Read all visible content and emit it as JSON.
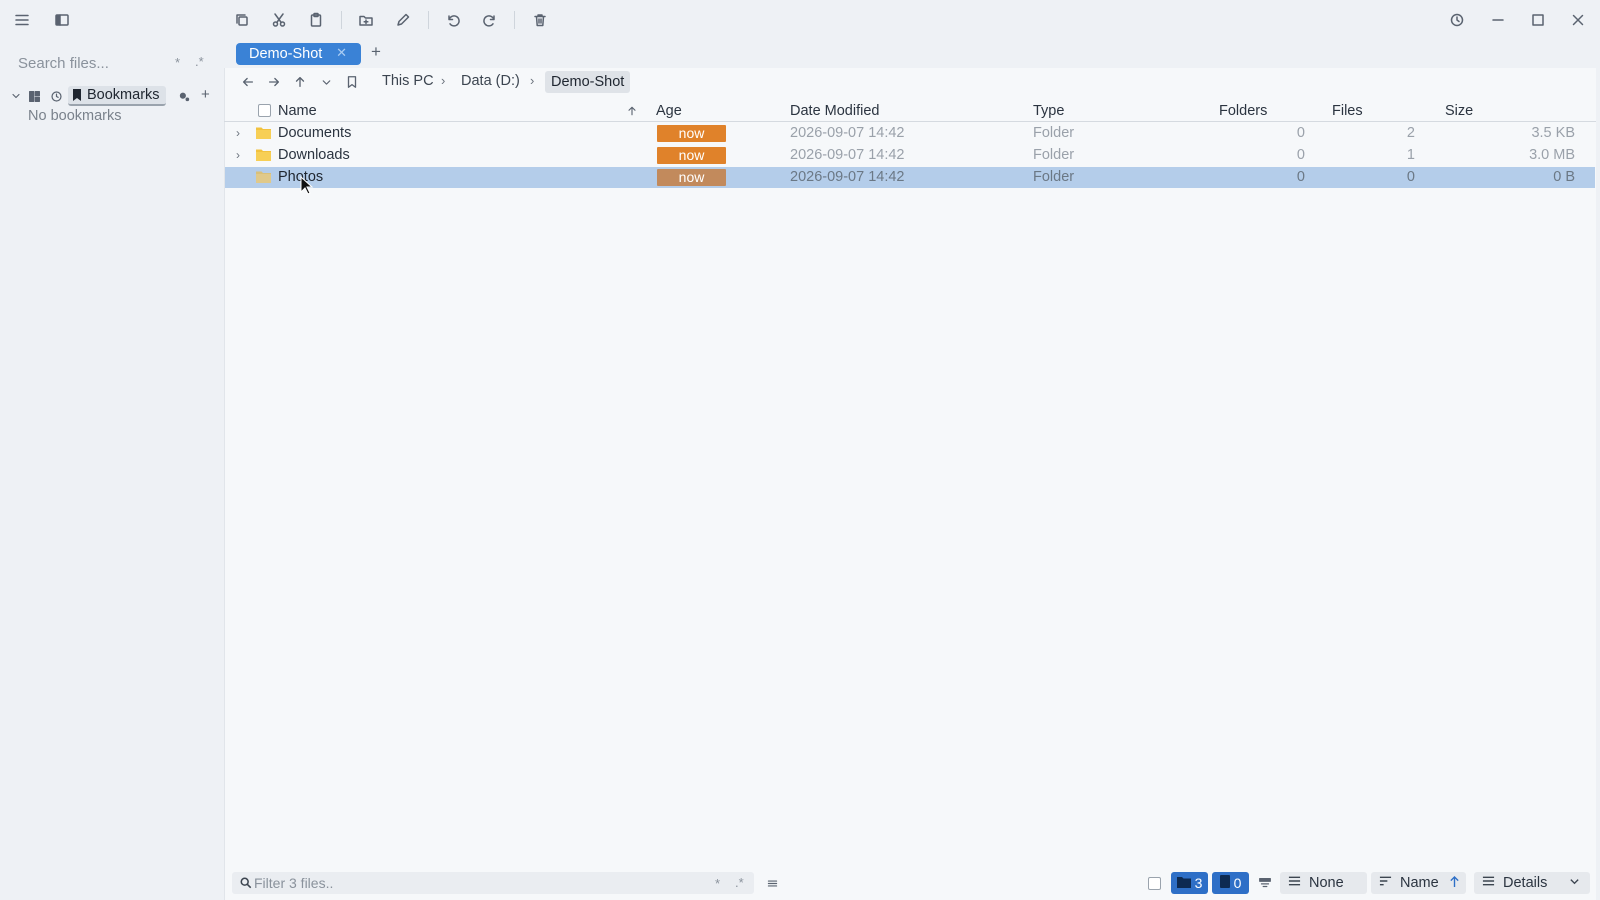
{
  "toolbar": {
    "colors": {
      "accent": "#3a82d6",
      "age_badge": "#e0822a"
    }
  },
  "sidebar": {
    "search_placeholder": "Search files...",
    "regex_star": "*",
    "regex_dotstar": ".*",
    "bookmarks_label": "Bookmarks",
    "add_label": "+",
    "empty_text": "No bookmarks"
  },
  "tabs": [
    {
      "label": "Demo-Shot",
      "close": "✕"
    }
  ],
  "tab_add": "+",
  "breadcrumb": [
    "This PC",
    "Data (D:)",
    "Demo-Shot"
  ],
  "table": {
    "columns": {
      "name": "Name",
      "age": "Age",
      "date": "Date Modified",
      "type": "Type",
      "folders": "Folders",
      "files": "Files",
      "size": "Size"
    },
    "rows": [
      {
        "name": "Documents",
        "age": "now",
        "date": "2026-09-07 14:42",
        "type": "Folder",
        "folders": "0",
        "files": "2",
        "size": "3.5 KB"
      },
      {
        "name": "Downloads",
        "age": "now",
        "date": "2026-09-07 14:42",
        "type": "Folder",
        "folders": "0",
        "files": "1",
        "size": "3.0 MB"
      },
      {
        "name": "Photos",
        "age": "now",
        "date": "2026-09-07 14:42",
        "type": "Folder",
        "folders": "0",
        "files": "0",
        "size": "0 B"
      }
    ]
  },
  "statusbar": {
    "filter_placeholder": "Filter 3 files..",
    "regex_star": "*",
    "regex_dotstar": ".*",
    "folder_count": "3",
    "file_count": "0",
    "group_label": "None",
    "sort_label": "Name",
    "view_label": "Details"
  }
}
